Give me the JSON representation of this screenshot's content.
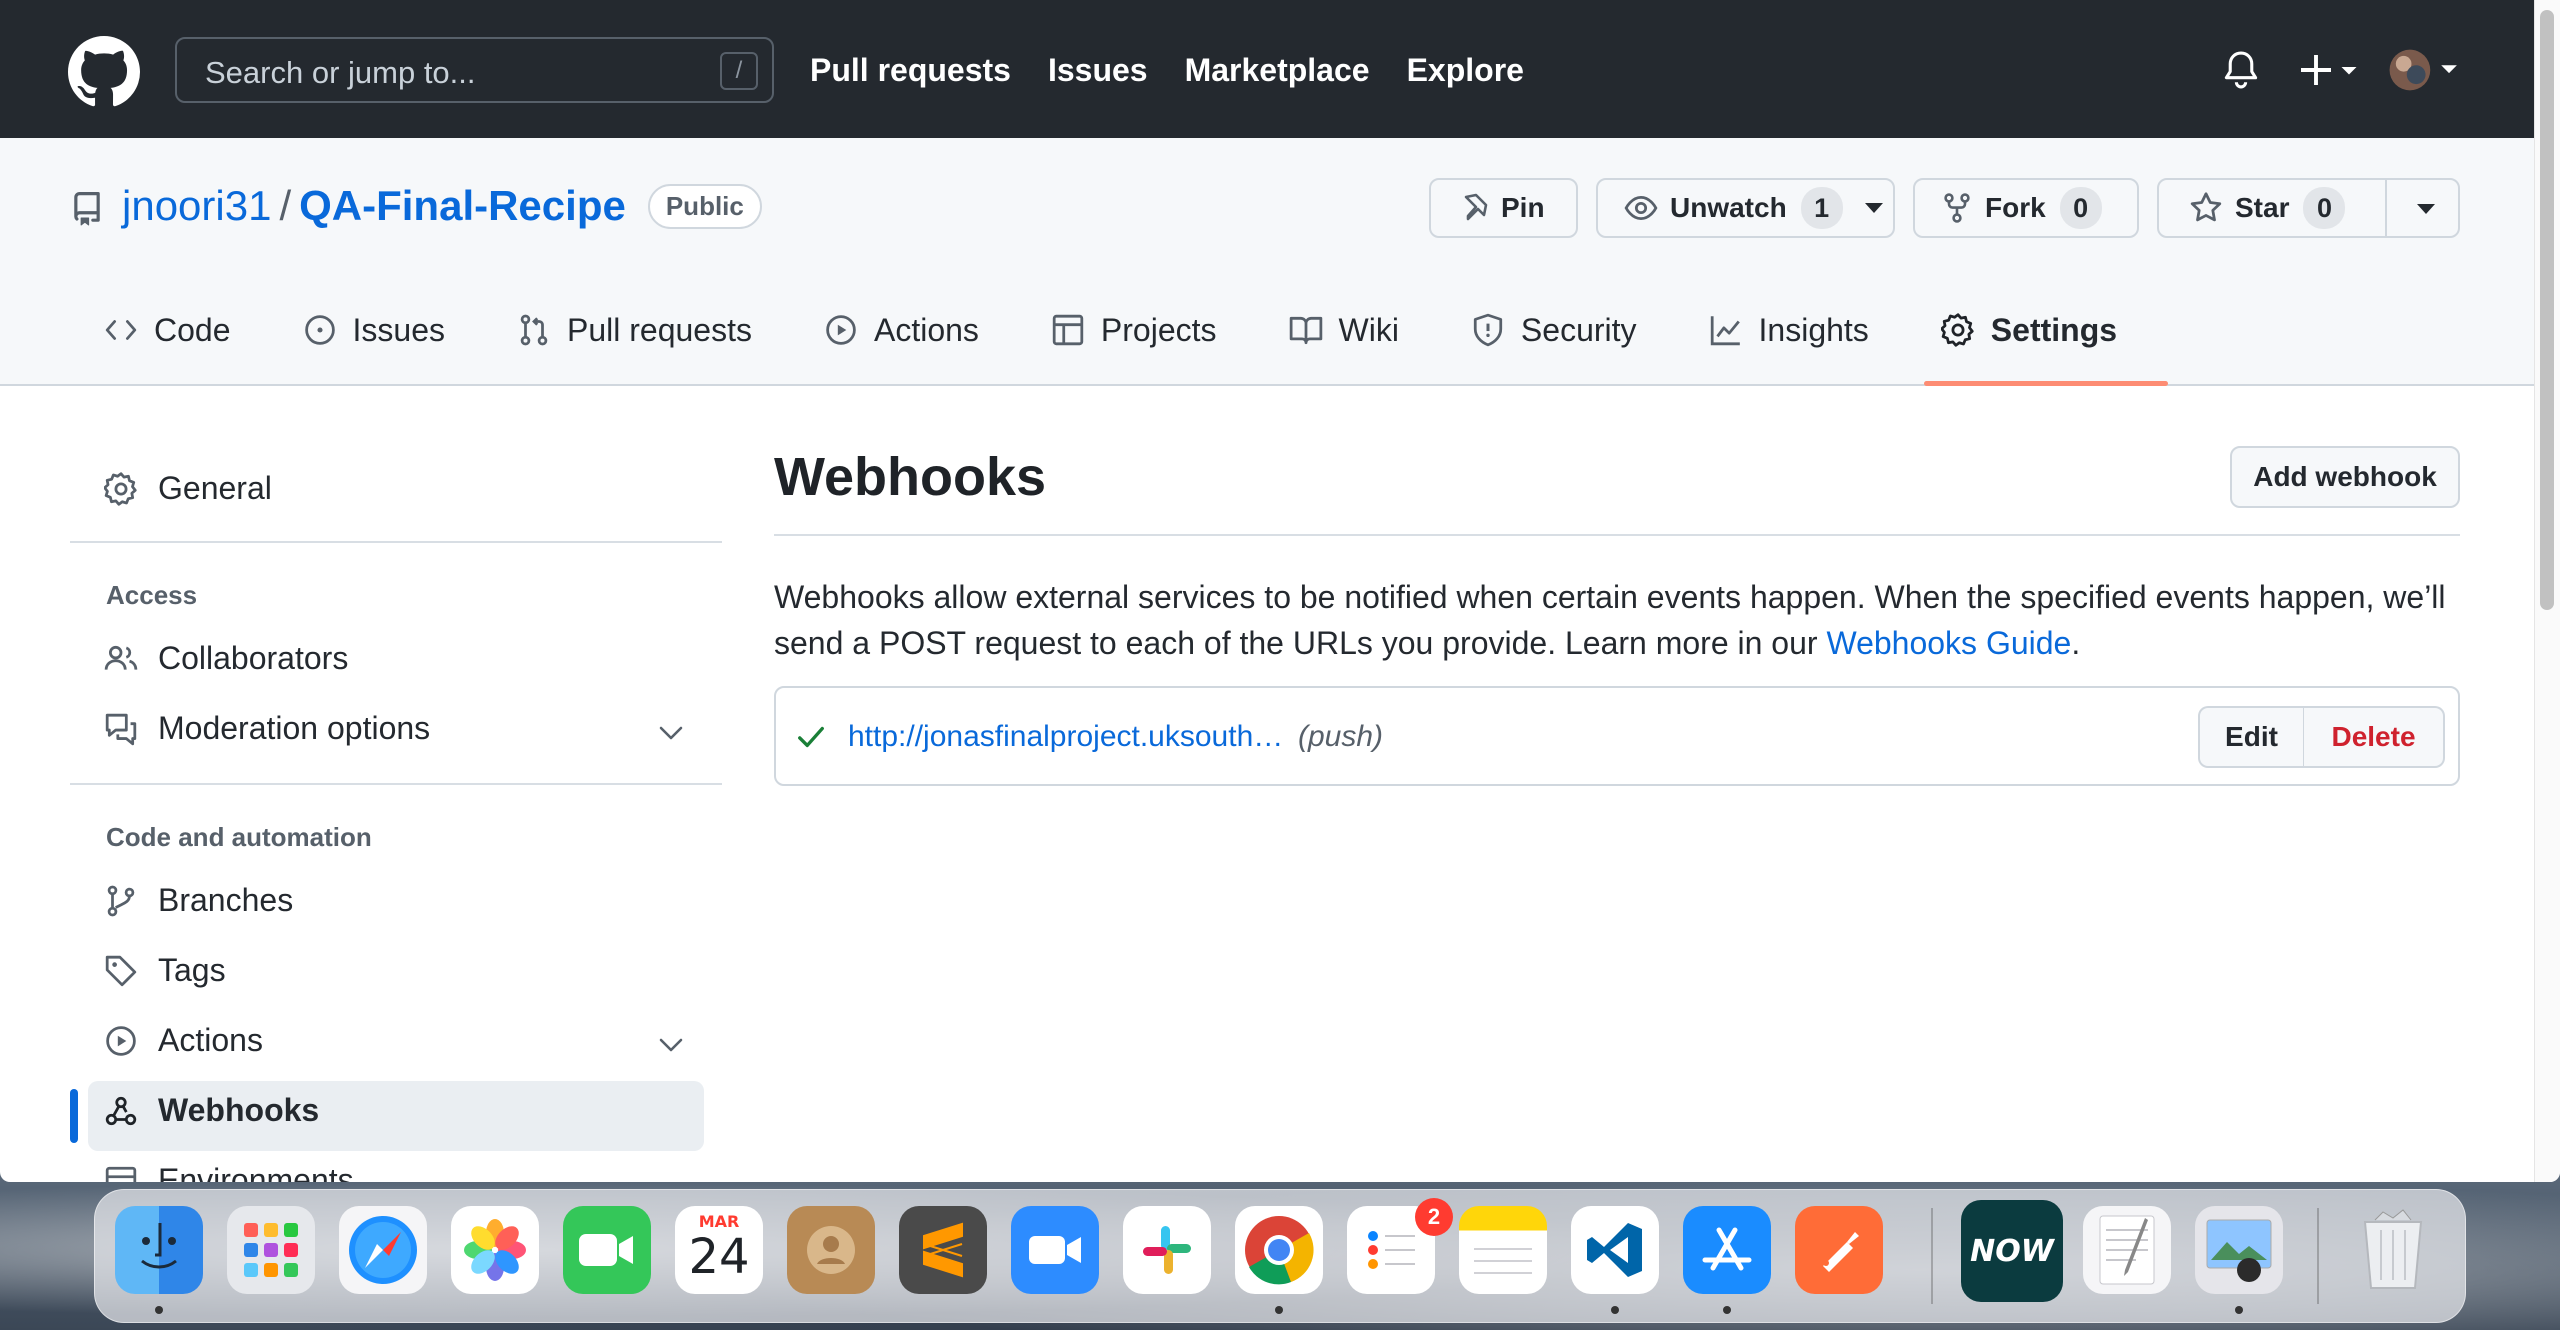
{
  "header": {
    "search_placeholder": "Search or jump to...",
    "search_shortcut": "/",
    "nav": [
      "Pull requests",
      "Issues",
      "Marketplace",
      "Explore"
    ]
  },
  "repo": {
    "owner": "jnoori31",
    "separator": "/",
    "name": "QA-Final-Recipe",
    "visibility": "Public",
    "pin_label": "Pin",
    "unwatch_label": "Unwatch",
    "watch_count": "1",
    "fork_label": "Fork",
    "fork_count": "0",
    "star_label": "Star",
    "star_count": "0"
  },
  "tabs": [
    {
      "label": "Code",
      "icon": "code-icon"
    },
    {
      "label": "Issues",
      "icon": "issue-icon"
    },
    {
      "label": "Pull requests",
      "icon": "pull-request-icon"
    },
    {
      "label": "Actions",
      "icon": "play-icon"
    },
    {
      "label": "Projects",
      "icon": "table-icon"
    },
    {
      "label": "Wiki",
      "icon": "book-icon"
    },
    {
      "label": "Security",
      "icon": "shield-icon"
    },
    {
      "label": "Insights",
      "icon": "graph-icon"
    },
    {
      "label": "Settings",
      "icon": "gear-icon",
      "active": true
    }
  ],
  "sidebar": {
    "general": "General",
    "access_heading": "Access",
    "collaborators": "Collaborators",
    "moderation": "Moderation options",
    "code_heading": "Code and automation",
    "branches": "Branches",
    "tags": "Tags",
    "actions": "Actions",
    "webhooks": "Webhooks",
    "environments": "Environments"
  },
  "main": {
    "title": "Webhooks",
    "add_button": "Add webhook",
    "description": "Webhooks allow external services to be notified when certain events happen. When the specified events happen, we’ll send a POST request to each of the URLs you provide. Learn more in our ",
    "guide_link": "Webhooks Guide",
    "description_end": ".",
    "hook": {
      "url": "http://jonasfinalproject.uksouth…",
      "event": "(push)",
      "status": "success",
      "edit": "Edit",
      "delete": "Delete"
    }
  },
  "dock": {
    "calendar_month": "MAR",
    "calendar_day": "24",
    "reminders_badge": "2",
    "now_label": "NOW"
  },
  "colors": {
    "header_bg": "#24292f",
    "link": "#0969da",
    "active_tab_underline": "#fd8c73",
    "danger": "#cf222e",
    "success": "#1a7f37"
  }
}
